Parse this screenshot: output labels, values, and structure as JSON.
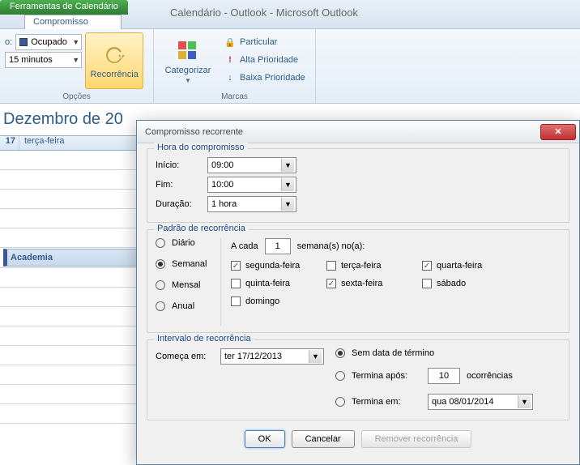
{
  "app": {
    "context_tab": "Ferramentas de Calendário",
    "tab": "Compromisso",
    "title": "Calendário - Outlook  -  Microsoft Outlook"
  },
  "ribbon": {
    "status_label": "Ocupado",
    "reminder_label": "15 minutos",
    "recurrence_btn": "Recorrência",
    "options_group": "Opções",
    "categorize_btn": "Categorizar",
    "private_label": "Particular",
    "high_priority_label": "Alta Prioridade",
    "low_priority_label": "Baixa Prioridade",
    "tags_group": "Marcas"
  },
  "calendar": {
    "month_partial": "Dezembro de 20",
    "day_num": "17",
    "day_name": "terça-feira",
    "event": "Academia"
  },
  "dialog": {
    "title": "Compromisso recorrente",
    "time_legend": "Hora do compromisso",
    "start_label": "Início:",
    "start_value": "09:00",
    "end_label": "Fim:",
    "end_value": "10:00",
    "duration_label": "Duração:",
    "duration_value": "1 hora",
    "pattern_legend": "Padrão de recorrência",
    "freq": {
      "daily": "Diário",
      "weekly": "Semanal",
      "monthly": "Mensal",
      "yearly": "Anual"
    },
    "every_prefix": "A cada",
    "every_value": "1",
    "every_suffix": "semana(s) no(a):",
    "days": {
      "mon": "segunda-feira",
      "tue": "terça-feira",
      "wed": "quarta-feira",
      "thu": "quinta-feira",
      "fri": "sexta-feira",
      "sat": "sábado",
      "sun": "domingo"
    },
    "range_legend": "Intervalo de recorrência",
    "range_start_label": "Começa em:",
    "range_start_value": "ter 17/12/2013",
    "no_end": "Sem data de término",
    "end_after_prefix": "Termina após:",
    "end_after_count": "10",
    "end_after_suffix": "ocorrências",
    "end_by_label": "Termina em:",
    "end_by_value": "qua 08/01/2014",
    "ok": "OK",
    "cancel": "Cancelar",
    "remove": "Remover recorrência"
  }
}
